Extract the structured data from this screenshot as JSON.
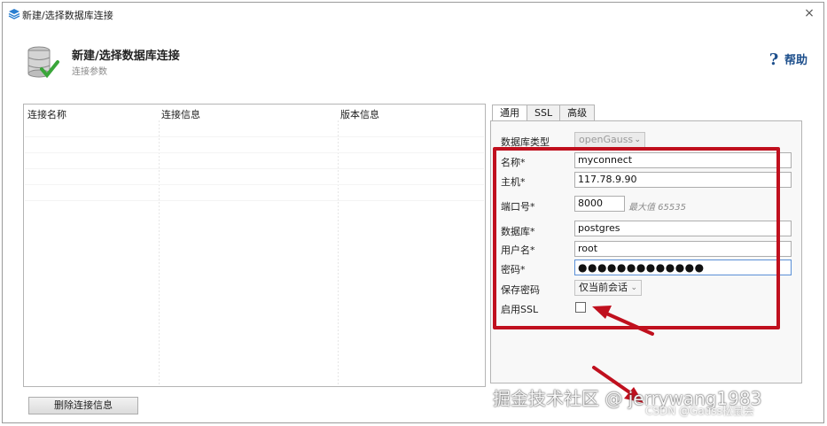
{
  "window": {
    "title": "新建/选择数据库连接",
    "close_glyph": "×"
  },
  "header": {
    "title": "新建/选择数据库连接",
    "subtitle": "连接参数",
    "help_label": "帮助",
    "icon": "database-check-icon"
  },
  "connection_list": {
    "columns": [
      "连接名称",
      "连接信息",
      "版本信息"
    ],
    "rows": []
  },
  "buttons": {
    "delete_connection": "删除连接信息"
  },
  "tabs": [
    {
      "label": "通用",
      "active": true
    },
    {
      "label": "SSL",
      "active": false
    },
    {
      "label": "高级",
      "active": false
    }
  ],
  "form": {
    "db_type": {
      "label": "数据库类型",
      "value": "openGauss"
    },
    "name": {
      "label": "名称*",
      "value": "myconnect"
    },
    "host": {
      "label": "主机*",
      "value": "117.78.9.90"
    },
    "port": {
      "label": "端口号*",
      "value": "8000",
      "hint": "最大值 65535"
    },
    "database": {
      "label": "数据库*",
      "value": "postgres"
    },
    "username": {
      "label": "用户名*",
      "value": "root"
    },
    "password": {
      "label": "密码*",
      "masked": "●●●●●●●●●●●●●"
    },
    "save_password": {
      "label": "保存密码",
      "value": "仅当前会话"
    },
    "enable_ssl": {
      "label": "启用SSL",
      "checked": false
    }
  },
  "annotations": {
    "highlight_color": "#c0101e"
  },
  "watermark": {
    "main": "掘金技术社区 @ jerrywang1983",
    "sub": "CSDN @Gauss松鼠会"
  }
}
